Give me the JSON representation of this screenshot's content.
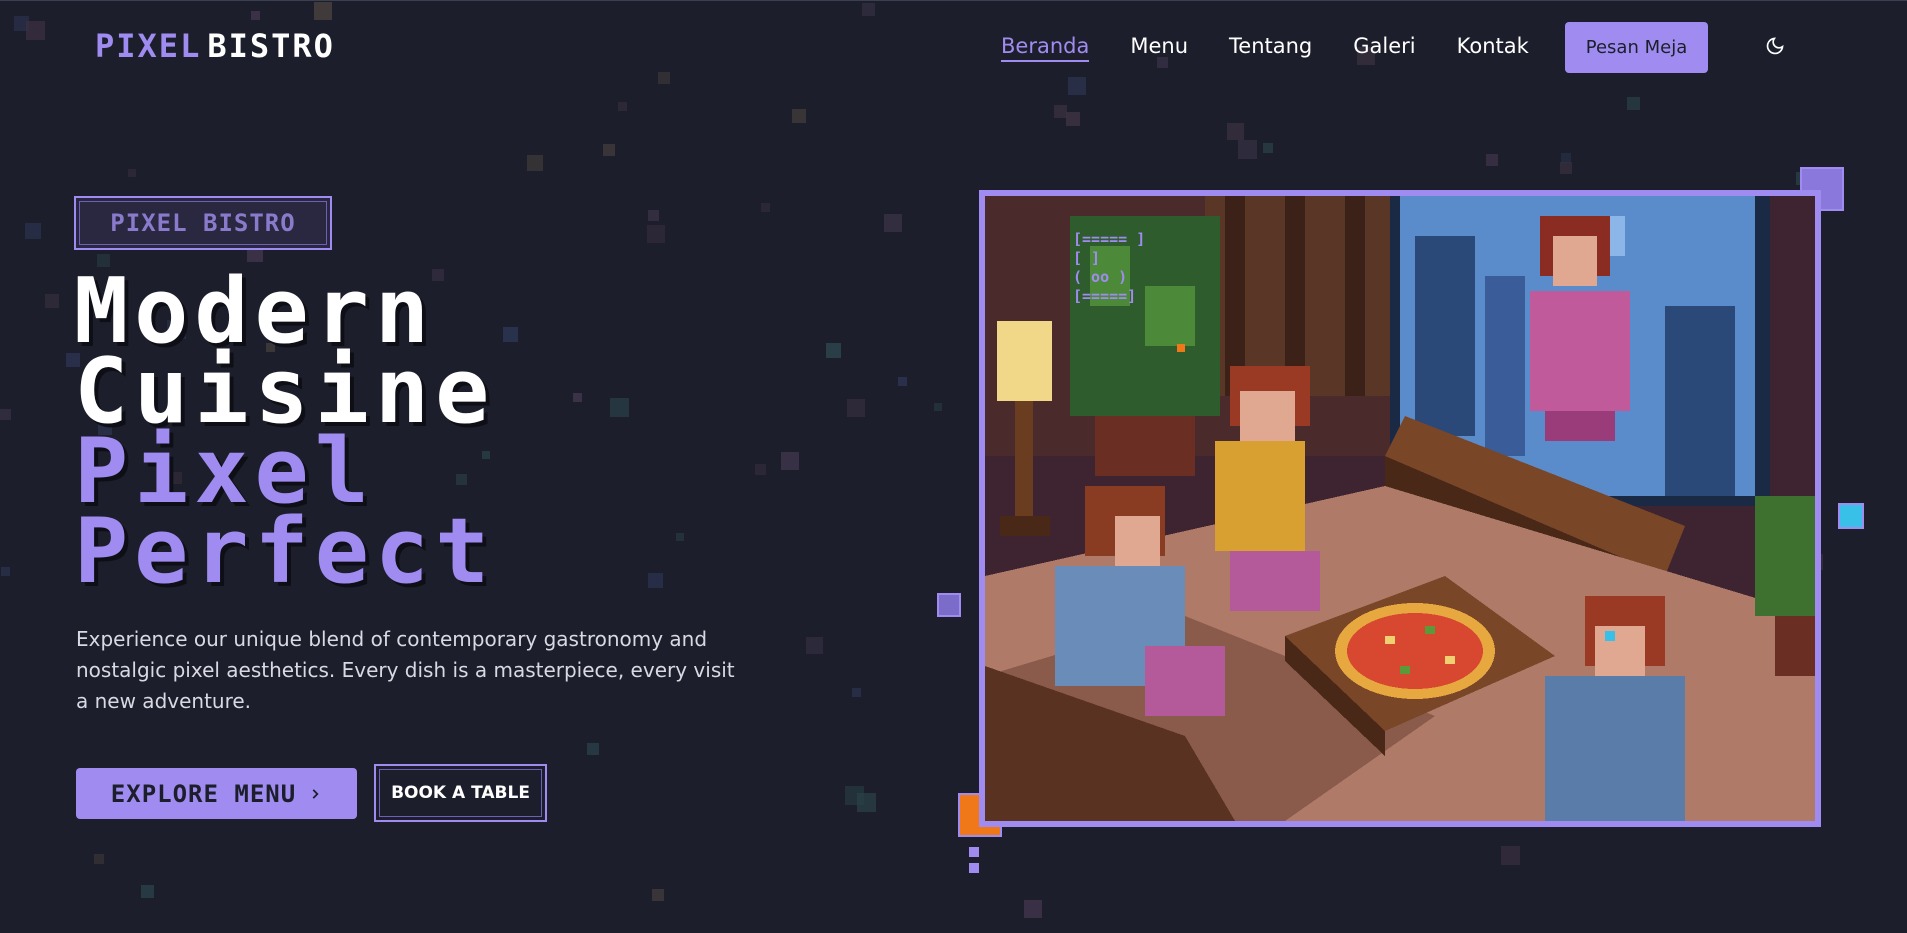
{
  "brand": {
    "part1": "PIXEL",
    "part2": "BISTRO"
  },
  "nav": {
    "items": [
      {
        "label": "Beranda",
        "active": true
      },
      {
        "label": "Menu",
        "active": false
      },
      {
        "label": "Tentang",
        "active": false
      },
      {
        "label": "Galeri",
        "active": false
      },
      {
        "label": "Kontak",
        "active": false
      }
    ],
    "cta_label": "Pesan Meja",
    "theme_icon": "moon-icon"
  },
  "hero": {
    "badge": "PIXEL BISTRO",
    "headline": [
      "Modern",
      "Cuisine",
      "Pixel",
      "Perfect"
    ],
    "lead": "Experience our unique blend of contemporary gastronomy and nostalgic pixel aesthetics. Every dish is a masterpiece, every visit a new adventure.",
    "explore_label": "EXPLORE MENU",
    "explore_icon": "chevron-right-icon",
    "book_label": "BOOK A TABLE",
    "image_icon": "pixel-restaurant-scene",
    "ascii_art": [
      "[===== ]",
      "[      ]",
      "( oo  )",
      "[=====]"
    ]
  },
  "colors": {
    "background": "#1c1f2b",
    "accent": "#a08cf0",
    "orange": "#f07818",
    "cyan": "#38c0e8"
  }
}
